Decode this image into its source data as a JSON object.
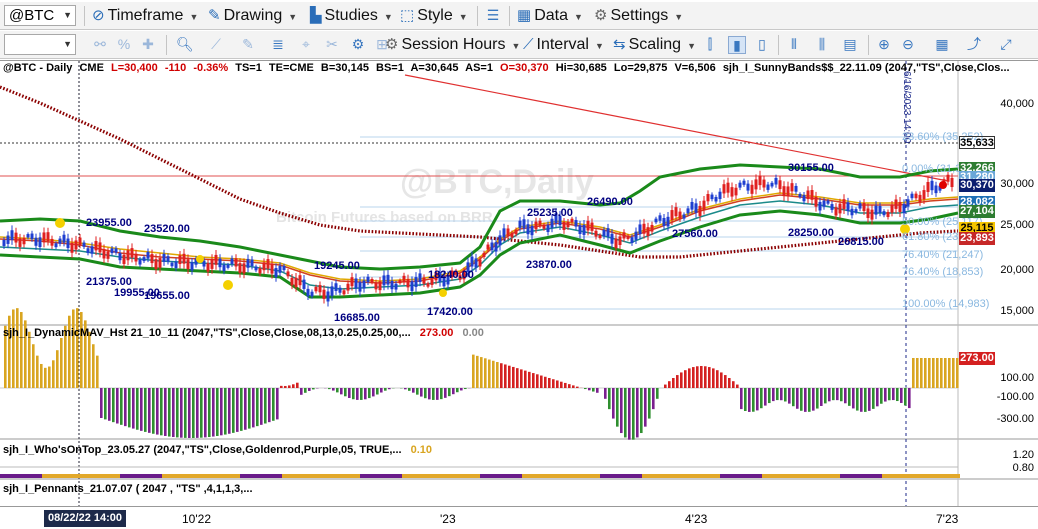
{
  "toolbar1": {
    "symbol": "@BTC",
    "timeframe": "Timeframe",
    "drawing": "Drawing",
    "studies": "Studies",
    "style": "Style",
    "data": "Data",
    "settings": "Settings"
  },
  "toolbar2": {
    "session_hours": "Session Hours",
    "interval": "Interval",
    "scaling": "Scaling"
  },
  "status": {
    "symbol": "@BTC - Daily",
    "exchange": "CME",
    "last": "L=30,400",
    "change": "-110",
    "change_pct": "-0.36%",
    "ts": "TS=1",
    "te": "TE=CME",
    "bid": "B=30,145",
    "bs": "BS=1",
    "ask": "A=30,645",
    "as": "AS=1",
    "open": "O=30,370",
    "high": "Hi=30,685",
    "low": "Lo=29,875",
    "volume": "V=6,506",
    "study": "sjh_I_SunnyBands$$_22.11.09 (2047,\"TS\",Close,Clos..."
  },
  "watermark": {
    "title": "@BTC,Daily",
    "subtitle": "Bitcoin Futures based on BRR"
  },
  "vertical_marker": "6/16/2023 14:00",
  "price_labels": [
    {
      "text": "23955.00"
    },
    {
      "text": "23520.00"
    },
    {
      "text": "21375.00"
    },
    {
      "text": "19955.00"
    },
    {
      "text": "19655.00"
    },
    {
      "text": "19245.00"
    },
    {
      "text": "18240.00"
    },
    {
      "text": "17420.00"
    },
    {
      "text": "16685.00"
    },
    {
      "text": "25235.00"
    },
    {
      "text": "26490.00"
    },
    {
      "text": "23870.00"
    },
    {
      "text": "30155.00"
    },
    {
      "text": "28250.00"
    },
    {
      "text": "26815.00"
    },
    {
      "text": "27560.00"
    }
  ],
  "fib_levels": [
    {
      "text": "23.60% (35,252)"
    },
    {
      "text": "0.00% (31,382)"
    },
    {
      "text": "50.00% (25,117)"
    },
    {
      "text": "61.80% (23,182)"
    },
    {
      "text": "76.40% (21,247)"
    },
    {
      "text": "76.40% (18,853)"
    },
    {
      "text": "100.00% (14,983)"
    }
  ],
  "price_axis": [
    "40,000",
    "35,000",
    "30,000",
    "25,000",
    "20,000",
    "15,000"
  ],
  "price_tags": [
    {
      "text": "35,633",
      "bg": "#ffffff",
      "fg": "#000000"
    },
    {
      "text": "32,266",
      "bg": "#2e7d32",
      "fg": "#ffffff"
    },
    {
      "text": "31,280",
      "bg": "#6aa7d8",
      "fg": "#ffffff"
    },
    {
      "text": "30,370",
      "bg": "#0b1e6e",
      "fg": "#ffffff"
    },
    {
      "text": "28,082",
      "bg": "#1e6fb5",
      "fg": "#ffffff"
    },
    {
      "text": "27,104",
      "bg": "#2e7d32",
      "fg": "#ffffff"
    },
    {
      "text": "25,115",
      "bg": "#f4c400",
      "fg": "#000000"
    },
    {
      "text": "23,893",
      "bg": "#c62828",
      "fg": "#ffffff"
    }
  ],
  "panel2": {
    "study": "sjh_I_DynamicMAV_Hst 21_10_11 (2047,\"TS\",Close,Close,08,13,0.25,0.25,00,...",
    "value1": "273.00",
    "value2": "0.00",
    "axis": [
      "273.00",
      "100.00",
      "-100.00",
      "-300.00"
    ]
  },
  "panel3": {
    "study": "sjh_I_Who'sOnTop_23.05.27 (2047,\"TS\",Close,Goldenrod,Purple,05,  TRUE,...",
    "value": "0.10",
    "axis": [
      "1.20",
      "0.80"
    ]
  },
  "panel4": {
    "study": "sjh_I_Pennants_21.07.07 ( 2047 , \"TS\" ,4,1,1,3,..."
  },
  "time_axis": {
    "cursor": "08/22/22 14:00",
    "ticks": [
      "10'22",
      "'23",
      "4'23",
      "7'23"
    ]
  },
  "colors": {
    "green_band": "#1a8a1a",
    "ma_red": "#8b0000",
    "candle_blue": "#1f3fd0",
    "candle_red": "#e02020",
    "hist_gold": "#d9a520",
    "hist_red": "#d42020",
    "hist_green": "#2f8f2f",
    "hist_purple": "#7b1f8f"
  }
}
